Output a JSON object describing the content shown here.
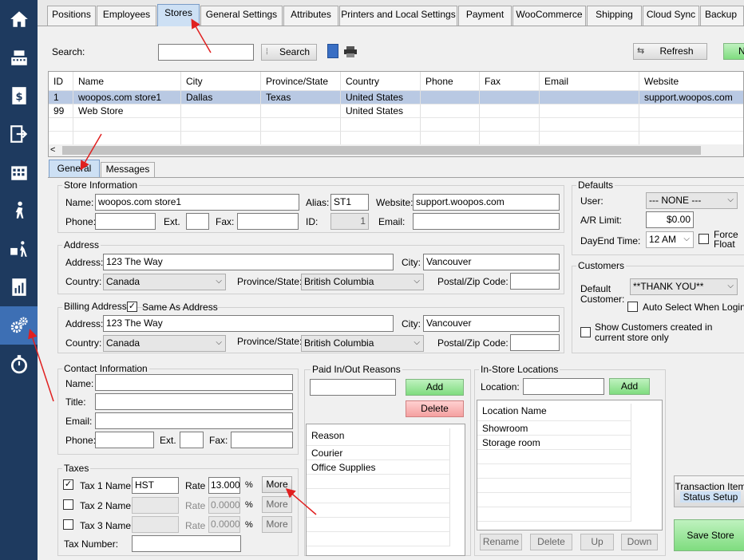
{
  "tabs": [
    "Positions",
    "Employees",
    "Stores",
    "General Settings",
    "Attributes",
    "Printers and Local Settings",
    "Payment",
    "WooCommerce",
    "Shipping",
    "Cloud Sync",
    "Backup"
  ],
  "search": {
    "label": "Search:",
    "value": "",
    "button": "Search",
    "refresh": "Refresh",
    "new_partial": "N"
  },
  "grid": {
    "columns": [
      "ID",
      "Name",
      "City",
      "Province/State",
      "Country",
      "Phone",
      "Fax",
      "Email",
      "Website"
    ],
    "rows": [
      [
        "1",
        "woopos.com store1",
        "Dallas",
        "Texas",
        "United States",
        "",
        "",
        "",
        "support.woopos.com"
      ],
      [
        "99",
        "Web Store",
        "",
        "",
        "United States",
        "",
        "",
        "",
        ""
      ]
    ],
    "scroll_left": "<"
  },
  "subtabs": [
    "General",
    "Messages"
  ],
  "store_info": {
    "title": "Store Information",
    "name_label": "Name:",
    "name": "woopos.com store1",
    "alias_label": "Alias:",
    "alias": "ST1",
    "website_label": "Website:",
    "website": "support.woopos.com",
    "phone_label": "Phone:",
    "phone": "",
    "ext_label": "Ext.",
    "ext": "",
    "fax_label": "Fax:",
    "fax": "",
    "id_label": "ID:",
    "id": "1",
    "email_label": "Email:",
    "email": ""
  },
  "address": {
    "title": "Address",
    "address_label": "Address:",
    "address": "123 The Way",
    "city_label": "City:",
    "city": "Vancouver",
    "country_label": "Country:",
    "country": "Canada",
    "province_label": "Province/State:",
    "province": "British Columbia",
    "postal_label": "Postal/Zip Code:",
    "postal": ""
  },
  "billing": {
    "title": "Billing Address -",
    "same_label": "Same As Address",
    "address_label": "Address:",
    "address": "123 The Way",
    "city_label": "City:",
    "city": "Vancouver",
    "country_label": "Country:",
    "country": "Canada",
    "province_label": "Province/State:",
    "province": "British Columbia",
    "postal_label": "Postal/Zip Code:",
    "postal": ""
  },
  "defaults": {
    "title": "Defaults",
    "user_label": "User:",
    "user": "--- NONE ---",
    "ar_label": "A/R Limit:",
    "ar": "$0.00",
    "dayend_label": "DayEnd Time:",
    "dayend": "12 AM",
    "force_float_1": "Force",
    "force_float_2": "Float"
  },
  "customers": {
    "title": "Customers",
    "default_label_1": "Default",
    "default_label_2": "Customer:",
    "default_value": "**THANK YOU**",
    "auto_select": "Auto Select When Login",
    "show_created_1": "Show Customers created in",
    "show_created_2": "current store only"
  },
  "contact": {
    "title": "Contact Information",
    "name_label": "Name:",
    "title_label": "Title:",
    "email_label": "Email:",
    "phone_label": "Phone:",
    "ext_label": "Ext.",
    "fax_label": "Fax:"
  },
  "taxes": {
    "title": "Taxes",
    "rate_label": "Rate",
    "pct": "%",
    "more": "More",
    "rows": [
      {
        "label": "Tax 1 Name",
        "name": "HST",
        "rate": "13.000",
        "checked": true
      },
      {
        "label": "Tax 2 Name",
        "name": "",
        "rate": "0.0000",
        "checked": false
      },
      {
        "label": "Tax 3 Name",
        "name": "",
        "rate": "0.0000",
        "checked": false
      }
    ],
    "number_label": "Tax Number:"
  },
  "paid": {
    "title": "Paid In/Out Reasons",
    "add": "Add",
    "delete": "Delete",
    "header": "Reason",
    "items": [
      "Courier",
      "Office Supplies"
    ]
  },
  "instore": {
    "title": "In-Store Locations",
    "location_label": "Location:",
    "add": "Add",
    "header": "Location Name",
    "items": [
      "Showroom",
      "Storage room"
    ],
    "rename": "Rename",
    "delete": "Delete",
    "up": "Up",
    "down": "Down"
  },
  "buttons": {
    "transaction_1": "Transaction Item",
    "transaction_2": "Status Setup",
    "save": "Save Store"
  },
  "colors": {
    "sidebar": "#1e3a5f",
    "active_sidebar": "#3d6fb4",
    "selected_row": "#b9c9e3",
    "arrow": "#e02020"
  }
}
